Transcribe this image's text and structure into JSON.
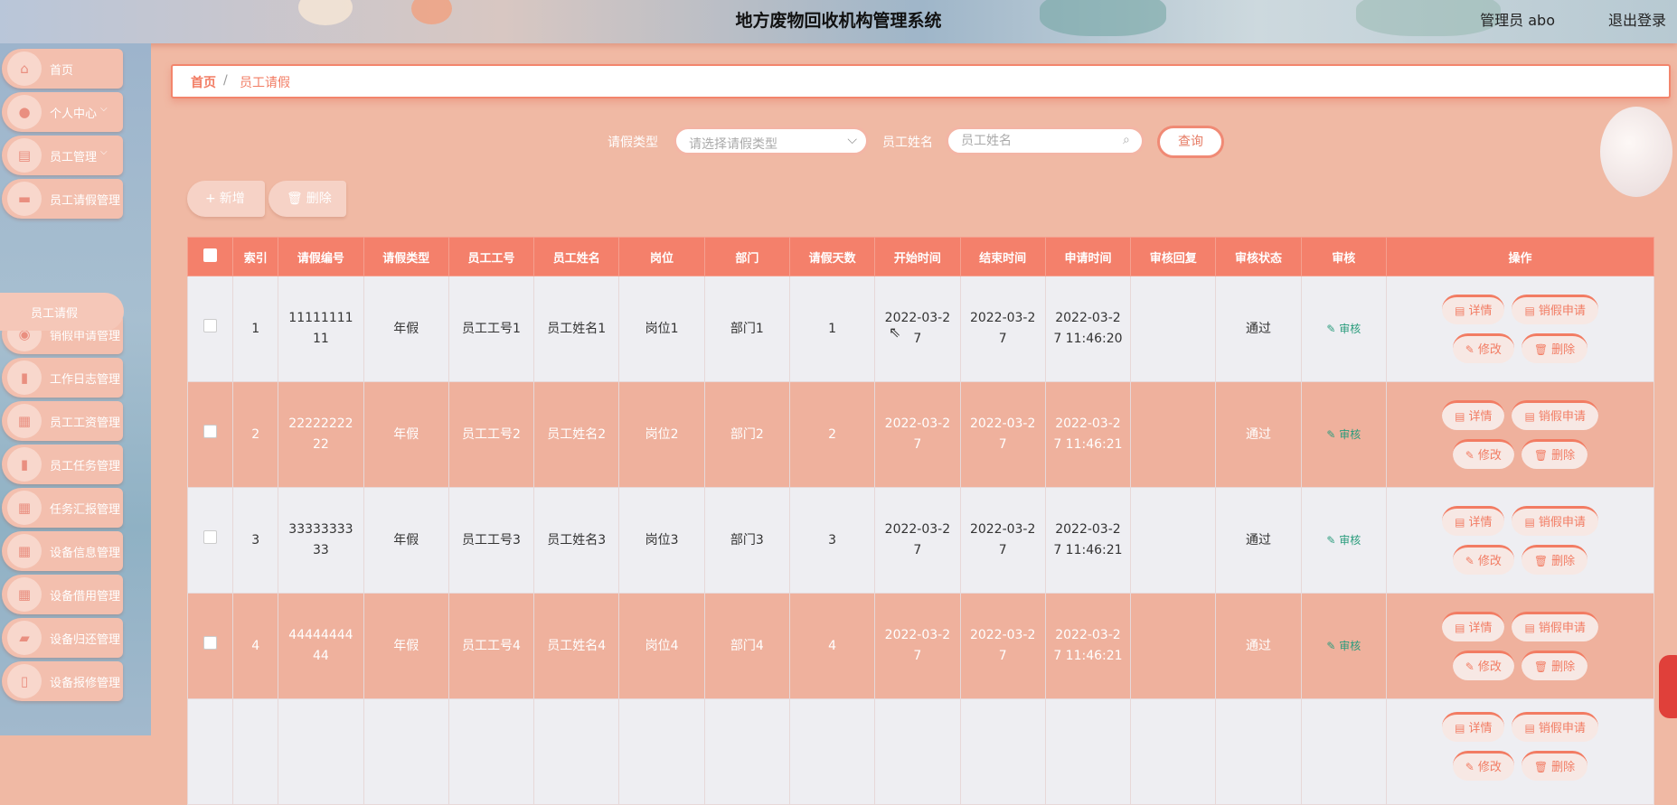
{
  "header": {
    "title": "地方废物回收机构管理系统",
    "user_role": "管理员 abo",
    "logout": "退出登录"
  },
  "sidebar": {
    "items": [
      {
        "label": "首页",
        "icon": "home-icon",
        "glyph": "⌂",
        "chevron": ""
      },
      {
        "label": "个人中心",
        "icon": "user-icon",
        "glyph": "●",
        "chevron": "⌵"
      },
      {
        "label": "员工管理",
        "icon": "chart-icon",
        "glyph": "▤",
        "chevron": "⌵"
      },
      {
        "label": "员工请假管理",
        "icon": "briefcase-icon",
        "glyph": "▬",
        "chevron": ""
      },
      {
        "label": "销假申请管理",
        "icon": "location-icon",
        "glyph": "◉",
        "chevron": ""
      },
      {
        "label": "工作日志管理",
        "icon": "clipboard-icon",
        "glyph": "▮",
        "chevron": ""
      },
      {
        "label": "员工工资管理",
        "icon": "grid-icon",
        "glyph": "▦",
        "chevron": ""
      },
      {
        "label": "员工任务管理",
        "icon": "clipboard-icon",
        "glyph": "▮",
        "chevron": ""
      },
      {
        "label": "任务汇报管理",
        "icon": "grid-icon",
        "glyph": "▦",
        "chevron": ""
      },
      {
        "label": "设备信息管理",
        "icon": "grid-icon",
        "glyph": "▦",
        "chevron": ""
      },
      {
        "label": "设备借用管理",
        "icon": "grid-icon",
        "glyph": "▦",
        "chevron": ""
      },
      {
        "label": "设备归还管理",
        "icon": "message-icon",
        "glyph": "▰",
        "chevron": ""
      },
      {
        "label": "设备报修管理",
        "icon": "document-icon",
        "glyph": "▯",
        "chevron": ""
      }
    ],
    "submenu_label": "员工请假"
  },
  "breadcrumb": {
    "home": "首页",
    "sep": "/",
    "current": "员工请假"
  },
  "search": {
    "type_label": "请假类型",
    "type_placeholder": "请选择请假类型",
    "name_label": "员工姓名",
    "name_placeholder": "员工姓名",
    "query_button": "查询"
  },
  "actions": {
    "add": "新增",
    "delete": "删除"
  },
  "table": {
    "headers": [
      "",
      "索引",
      "请假编号",
      "请假类型",
      "员工工号",
      "员工姓名",
      "岗位",
      "部门",
      "请假天数",
      "开始时间",
      "结束时间",
      "申请时间",
      "审核回复",
      "审核状态",
      "审核",
      "操作"
    ],
    "rows": [
      {
        "index": "1",
        "code": "1111111111",
        "type": "年假",
        "emp_no": "员工工号1",
        "emp_name": "员工姓名1",
        "post": "岗位1",
        "dept": "部门1",
        "days": "1",
        "start": "2022-03-27",
        "end": "2022-03-27",
        "apply": "2022-03-27 11:46:20",
        "reply": "",
        "status": "通过",
        "audit": "审核"
      },
      {
        "index": "2",
        "code": "2222222222",
        "type": "年假",
        "emp_no": "员工工号2",
        "emp_name": "员工姓名2",
        "post": "岗位2",
        "dept": "部门2",
        "days": "2",
        "start": "2022-03-27",
        "end": "2022-03-27",
        "apply": "2022-03-27 11:46:21",
        "reply": "",
        "status": "通过",
        "audit": "审核"
      },
      {
        "index": "3",
        "code": "3333333333",
        "type": "年假",
        "emp_no": "员工工号3",
        "emp_name": "员工姓名3",
        "post": "岗位3",
        "dept": "部门3",
        "days": "3",
        "start": "2022-03-27",
        "end": "2022-03-27",
        "apply": "2022-03-27 11:46:21",
        "reply": "",
        "status": "通过",
        "audit": "审核"
      },
      {
        "index": "4",
        "code": "4444444444",
        "type": "年假",
        "emp_no": "员工工号4",
        "emp_name": "员工姓名4",
        "post": "岗位4",
        "dept": "部门4",
        "days": "4",
        "start": "2022-03-27",
        "end": "2022-03-27",
        "apply": "2022-03-27 11:46:21",
        "reply": "",
        "status": "通过",
        "audit": "审核"
      },
      {
        "index": "",
        "code": "",
        "type": "",
        "emp_no": "",
        "emp_name": "",
        "post": "",
        "dept": "",
        "days": "",
        "start": "",
        "end": "",
        "apply": "",
        "reply": "",
        "status": "",
        "audit": ""
      }
    ],
    "row_ops": {
      "detail": "详情",
      "cancel_leave": "销假申请",
      "edit": "修改",
      "delete": "删除"
    }
  },
  "colors": {
    "accent": "#f4806b",
    "sidebar_bg": "#9db4cc",
    "row_even": "#efb19d",
    "row_odd": "#eeeef2"
  }
}
